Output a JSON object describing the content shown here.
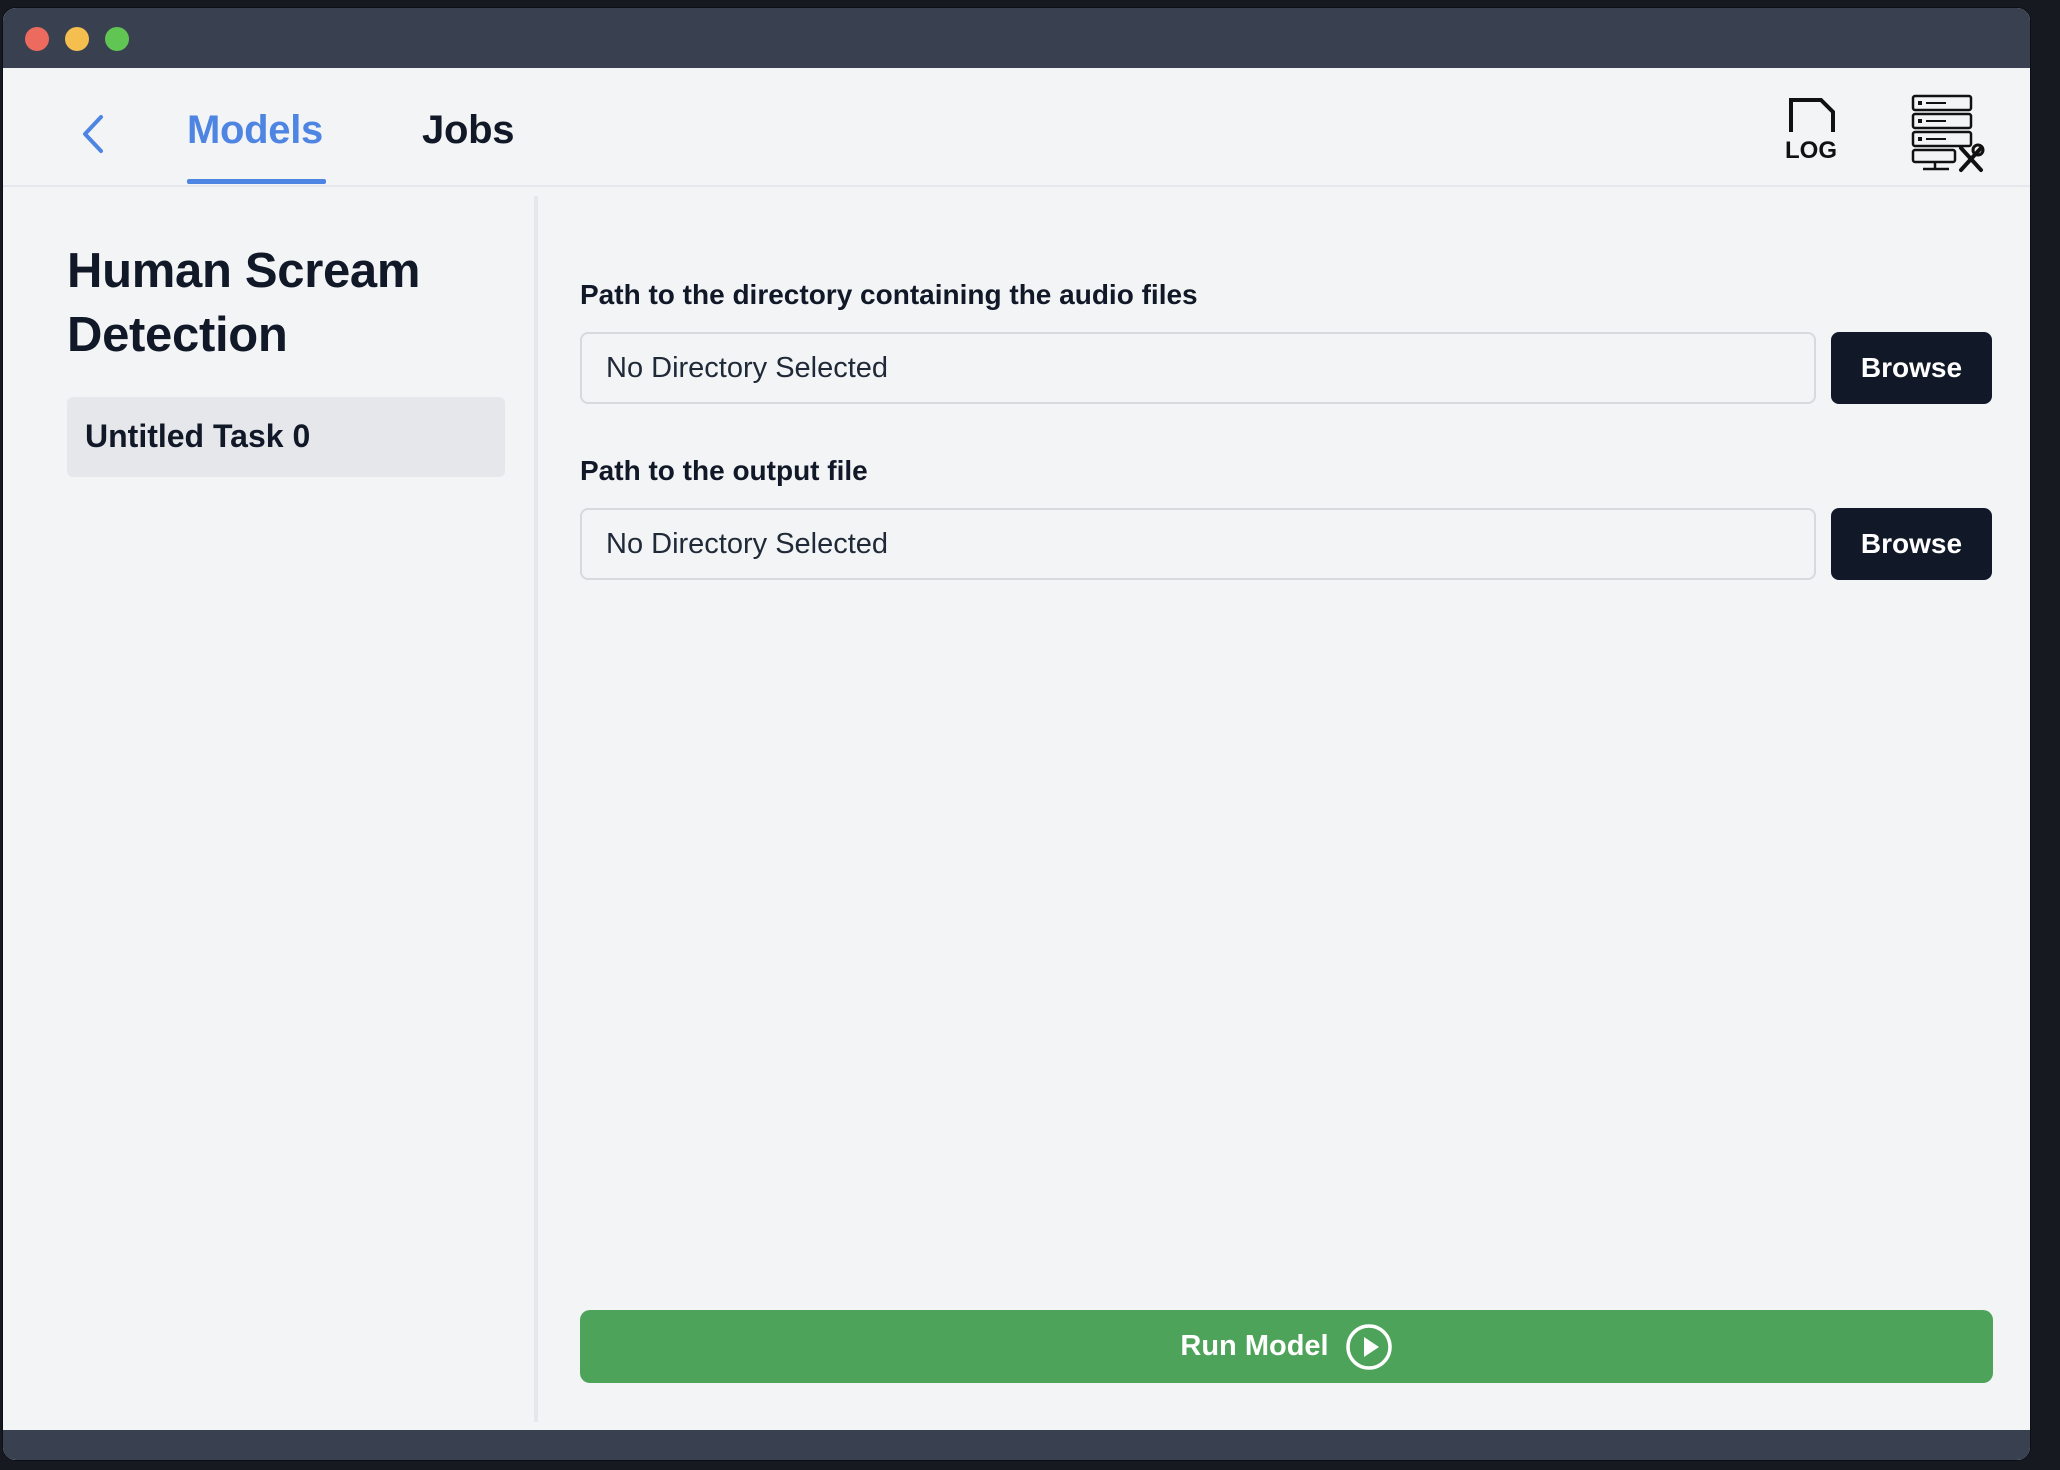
{
  "window": {
    "traffic_lights": [
      "close",
      "minimize",
      "zoom"
    ]
  },
  "nav": {
    "back_icon": "chevron-left-icon",
    "tabs": [
      {
        "label": "Models",
        "active": true
      },
      {
        "label": "Jobs",
        "active": false
      }
    ],
    "log_icon_text": "LOG",
    "accent_color": "#4e85e3"
  },
  "sidebar": {
    "model_title": "Human Scream Detection",
    "tasks": [
      {
        "label": "Untitled Task 0",
        "selected": true
      }
    ]
  },
  "form": {
    "fields": [
      {
        "label": "Path to the directory containing the audio files",
        "value": "No Directory Selected",
        "button": "Browse"
      },
      {
        "label": "Path to the output file",
        "value": "No Directory Selected",
        "button": "Browse"
      }
    ],
    "run_button": {
      "label": "Run Model",
      "icon": "play-circle-icon",
      "color": "#4ea35a"
    }
  }
}
